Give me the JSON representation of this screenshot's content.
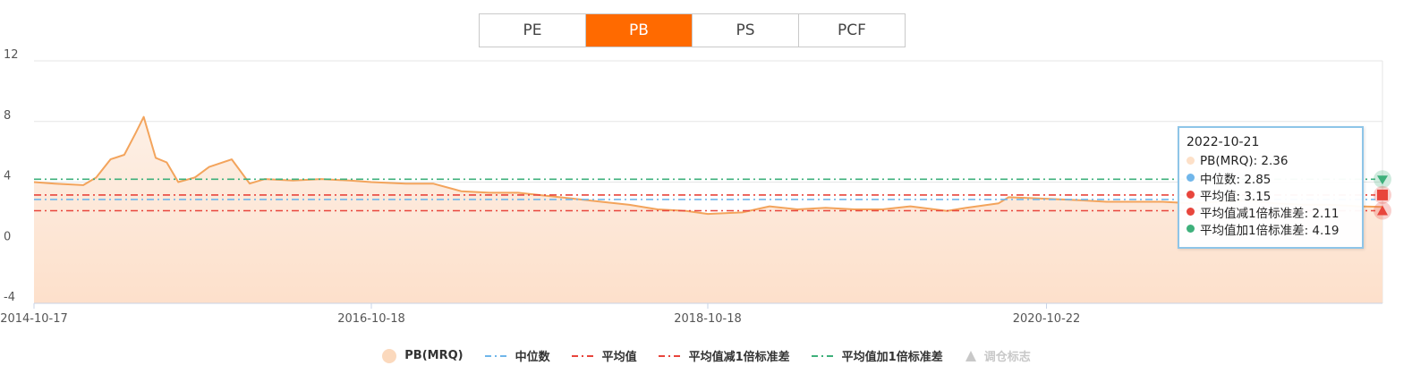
{
  "tabs": [
    {
      "label": "PE",
      "active": false
    },
    {
      "label": "PB",
      "active": true
    },
    {
      "label": "PS",
      "active": false
    },
    {
      "label": "PCF",
      "active": false
    }
  ],
  "tooltip": {
    "date": "2022-10-21",
    "rows": [
      {
        "text": "PB(MRQ): 2.36",
        "color": "#fde0c8"
      },
      {
        "text": "中位数: 2.85",
        "color": "#70b6ea"
      },
      {
        "text": "平均值: 3.15",
        "color": "#e8453c"
      },
      {
        "text": "平均值减1倍标准差: 2.11",
        "color": "#e8453c"
      },
      {
        "text": "平均值加1倍标准差: 4.19",
        "color": "#3eb07b"
      }
    ]
  },
  "legend": [
    {
      "label": "PB(MRQ)",
      "kind": "circle",
      "color": "#fbd9bd"
    },
    {
      "label": "中位数",
      "kind": "dash",
      "color": "#70b6ea"
    },
    {
      "label": "平均值",
      "kind": "dash",
      "color": "#e8453c"
    },
    {
      "label": "平均值减1倍标准差",
      "kind": "dash",
      "color": "#e8453c"
    },
    {
      "label": "平均值加1倍标准差",
      "kind": "dash",
      "color": "#3eb07b"
    },
    {
      "label": "调仓标志",
      "kind": "triangle",
      "color": "#c8c8c8",
      "disabled": true
    }
  ],
  "colors": {
    "series_line": "#f3a45c",
    "area_top": "#fdebdd",
    "area_bottom": "#fde2cf",
    "grid": "#e6e6e6",
    "axis": "#c8d3e6"
  },
  "chart_data": {
    "type": "area",
    "ylim": [
      -4,
      12
    ],
    "yticks": [
      -4,
      0,
      4,
      8,
      12
    ],
    "xlim": [
      "2014-10-17",
      "2022-10-21"
    ],
    "xticks": [
      "2014-10-17",
      "2016-10-18",
      "2018-10-18",
      "2020-10-22"
    ],
    "series": [
      {
        "name": "PB(MRQ)",
        "type": "area",
        "points": [
          [
            "2014-10-17",
            4.0
          ],
          [
            "2014-12-01",
            3.9
          ],
          [
            "2015-02-01",
            3.8
          ],
          [
            "2015-03-01",
            4.3
          ],
          [
            "2015-04-01",
            5.5
          ],
          [
            "2015-05-01",
            5.8
          ],
          [
            "2015-05-25",
            7.2
          ],
          [
            "2015-06-12",
            8.3
          ],
          [
            "2015-07-08",
            5.6
          ],
          [
            "2015-08-01",
            5.3
          ],
          [
            "2015-08-26",
            4.0
          ],
          [
            "2015-10-01",
            4.3
          ],
          [
            "2015-11-01",
            5.0
          ],
          [
            "2015-12-20",
            5.5
          ],
          [
            "2016-01-28",
            3.9
          ],
          [
            "2016-03-01",
            4.2
          ],
          [
            "2016-05-01",
            4.1
          ],
          [
            "2016-07-01",
            4.2
          ],
          [
            "2016-09-01",
            4.1
          ],
          [
            "2016-10-18",
            4.0
          ],
          [
            "2017-01-01",
            3.9
          ],
          [
            "2017-03-01",
            3.9
          ],
          [
            "2017-05-01",
            3.4
          ],
          [
            "2017-07-01",
            3.3
          ],
          [
            "2017-09-01",
            3.3
          ],
          [
            "2017-11-01",
            3.1
          ],
          [
            "2018-01-01",
            2.9
          ],
          [
            "2018-03-01",
            2.7
          ],
          [
            "2018-05-01",
            2.5
          ],
          [
            "2018-07-01",
            2.2
          ],
          [
            "2018-09-01",
            2.1
          ],
          [
            "2018-10-18",
            1.9
          ],
          [
            "2019-01-01",
            2.0
          ],
          [
            "2019-03-01",
            2.4
          ],
          [
            "2019-05-01",
            2.2
          ],
          [
            "2019-07-01",
            2.3
          ],
          [
            "2019-09-01",
            2.2
          ],
          [
            "2019-11-01",
            2.2
          ],
          [
            "2020-01-01",
            2.4
          ],
          [
            "2020-03-20",
            2.1
          ],
          [
            "2020-05-01",
            2.3
          ],
          [
            "2020-07-10",
            2.6
          ],
          [
            "2020-08-01",
            3.0
          ],
          [
            "2020-10-22",
            2.9
          ],
          [
            "2021-01-01",
            2.8
          ],
          [
            "2021-03-01",
            2.7
          ],
          [
            "2021-05-01",
            2.7
          ],
          [
            "2021-07-01",
            2.7
          ],
          [
            "2021-09-01",
            2.6
          ],
          [
            "2021-11-01",
            2.7
          ],
          [
            "2022-01-01",
            2.8
          ],
          [
            "2022-03-01",
            2.6
          ],
          [
            "2022-05-01",
            2.5
          ],
          [
            "2022-07-01",
            2.5
          ],
          [
            "2022-09-01",
            2.4
          ],
          [
            "2022-10-21",
            2.36
          ]
        ]
      },
      {
        "name": "中位数",
        "type": "hline",
        "value": 2.85
      },
      {
        "name": "平均值",
        "type": "hline",
        "value": 3.15
      },
      {
        "name": "平均值减1倍标准差",
        "type": "hline",
        "value": 2.11
      },
      {
        "name": "平均值加1倍标准差",
        "type": "hline",
        "value": 4.19
      }
    ],
    "end_markers": [
      {
        "shape": "triangle-down",
        "value": 4.19,
        "color": "#3eb07b"
      },
      {
        "shape": "square",
        "value": 3.15,
        "color": "#e8453c"
      },
      {
        "shape": "triangle-up",
        "value": 2.11,
        "color": "#e8453c"
      }
    ],
    "grid": true,
    "legend_position": "bottom"
  }
}
